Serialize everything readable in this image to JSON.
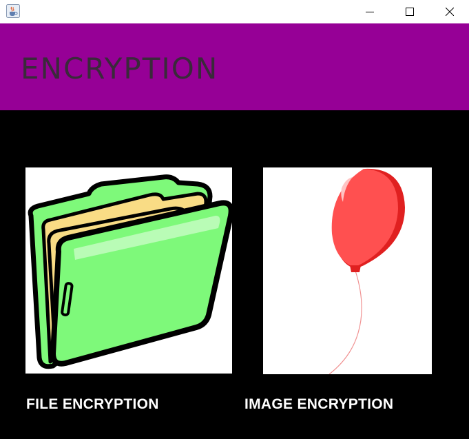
{
  "window": {
    "app_icon": "java-coffee-cup-icon",
    "controls": [
      "minimize-icon",
      "maximize-icon",
      "close-icon"
    ]
  },
  "header": {
    "title": "ENCRYPTION",
    "background": "#960096",
    "title_color": "#3a2a3a"
  },
  "options": [
    {
      "label": "FILE ENCRYPTION",
      "icon": "folder-icon",
      "icon_colors": {
        "front": "#7ef97a",
        "paper": "#f9dc85"
      }
    },
    {
      "label": "IMAGE ENCRYPTION",
      "icon": "balloon-icon",
      "icon_colors": {
        "balloon": "#ff4d4d"
      }
    }
  ]
}
